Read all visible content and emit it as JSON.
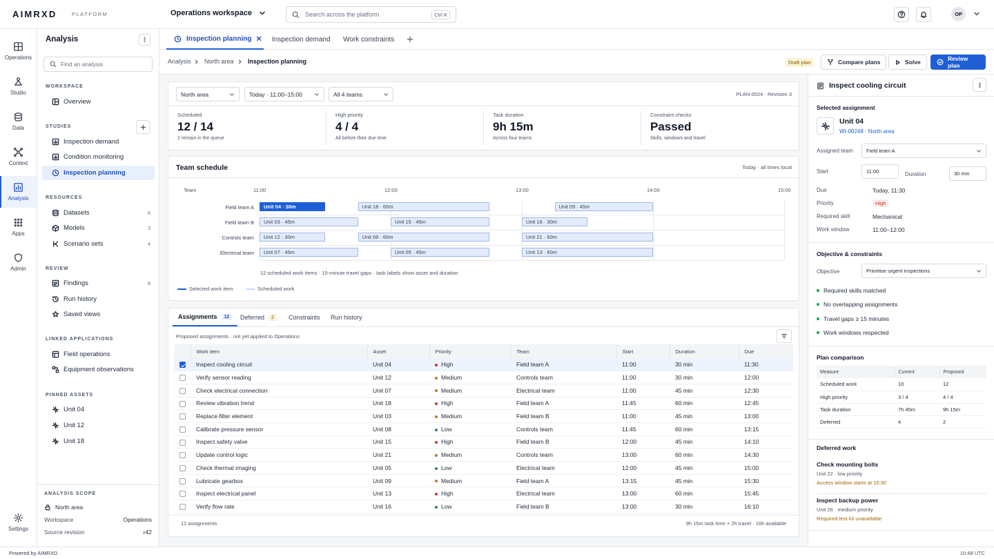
{
  "brand": {
    "name": "AIMRXD",
    "sub": "PLATFORM"
  },
  "workspace": "Operations workspace",
  "search": {
    "placeholder": "Search across the platform",
    "shortcut": "Ctrl K"
  },
  "user_initials": "OP",
  "rail": [
    {
      "label": "Operations",
      "icon": "grid-icon"
    },
    {
      "label": "Studio",
      "icon": "studio-icon"
    },
    {
      "label": "Data",
      "icon": "database-icon"
    },
    {
      "label": "Context",
      "icon": "graph-icon"
    },
    {
      "label": "Analysis",
      "icon": "chart-icon"
    },
    {
      "label": "Apps",
      "icon": "apps-icon"
    },
    {
      "label": "Admin",
      "icon": "shield-icon"
    }
  ],
  "rail_settings": "Settings",
  "sidebar": {
    "title": "Analysis",
    "search_placeholder": "Find an analysis",
    "workspace_head": "WORKSPACE",
    "overview": "Overview",
    "studies_head": "STUDIES",
    "studies": [
      "Inspection demand",
      "Condition monitoring",
      "Inspection planning"
    ],
    "resources_head": "RESOURCES",
    "resources": [
      {
        "label": "Datasets",
        "count": "6"
      },
      {
        "label": "Models",
        "count": "3"
      },
      {
        "label": "Scenario sets",
        "count": "4"
      }
    ],
    "review_head": "REVIEW",
    "review": [
      {
        "label": "Findings",
        "count": "8"
      },
      {
        "label": "Run history",
        "count": ""
      },
      {
        "label": "Saved views",
        "count": ""
      }
    ],
    "linked_head": "LINKED APPLICATIONS",
    "linked": [
      "Field operations",
      "Equipment observations"
    ],
    "pinned_head": "PINNED ASSETS",
    "pinned": [
      "Unit 04",
      "Unit 12",
      "Unit 18"
    ],
    "scope_head": "ANALYSIS SCOPE",
    "scope_area": "North area",
    "scope_workspace_label": "Workspace",
    "scope_workspace": "Operations",
    "scope_rev_label": "Source revision",
    "scope_rev": "r42"
  },
  "tabs": [
    "Inspection planning",
    "Inspection demand",
    "Work constraints"
  ],
  "breadcrumb": [
    "Analysis",
    "North area",
    "Inspection planning"
  ],
  "actions": {
    "draft": "Draft plan",
    "compare": "Compare plans",
    "solve": "Solve",
    "review": "Review plan"
  },
  "filters": {
    "area": "North area",
    "window": "Today · 11:00–15:00",
    "teams": "All 4 teams",
    "plan_id": "PLAN-0024 · Revision 3"
  },
  "kpis": [
    {
      "label": "Scheduled",
      "value": "12 / 14",
      "sub": "2 remain in the queue"
    },
    {
      "label": "High priority",
      "value": "4 / 4",
      "sub": "All before their due time"
    },
    {
      "label": "Task duration",
      "value": "9h 15m",
      "sub": "Across four teams"
    },
    {
      "label": "Constraint checks",
      "value": "Passed",
      "sub": "Skills, windows and travel"
    }
  ],
  "schedule": {
    "title": "Team schedule",
    "note": "Today · all times local",
    "team_col": "Team",
    "times": [
      "11:00",
      "12:00",
      "13:00",
      "14:00",
      "15:00"
    ],
    "teams": [
      "Field team A",
      "Field team B",
      "Controls team",
      "Electrical team"
    ],
    "tasks": [
      {
        "team": 0,
        "label": "Unit 04 · 30m",
        "start": 11.0,
        "end": 11.5,
        "selected": true
      },
      {
        "team": 0,
        "label": "Unit 18 · 60m",
        "start": 11.75,
        "end": 12.75,
        "selected": false
      },
      {
        "team": 0,
        "label": "Unit 09 · 45m",
        "start": 13.25,
        "end": 14.0,
        "selected": false
      },
      {
        "team": 1,
        "label": "Unit 03 · 45m",
        "start": 11.0,
        "end": 11.75,
        "selected": false
      },
      {
        "team": 1,
        "label": "Unit 15 · 45m",
        "start": 12.0,
        "end": 12.75,
        "selected": false
      },
      {
        "team": 1,
        "label": "Unit 16 · 30m",
        "start": 13.0,
        "end": 13.5,
        "selected": false
      },
      {
        "team": 2,
        "label": "Unit 12 · 30m",
        "start": 11.0,
        "end": 11.5,
        "selected": false
      },
      {
        "team": 2,
        "label": "Unit 08 · 60m",
        "start": 11.75,
        "end": 12.75,
        "selected": false
      },
      {
        "team": 2,
        "label": "Unit 21 · 60m",
        "start": 13.0,
        "end": 14.0,
        "selected": false
      },
      {
        "team": 3,
        "label": "Unit 07 · 45m",
        "start": 11.0,
        "end": 11.75,
        "selected": false
      },
      {
        "team": 3,
        "label": "Unit 05 · 45m",
        "start": 12.0,
        "end": 12.75,
        "selected": false
      },
      {
        "team": 3,
        "label": "Unit 13 · 60m",
        "start": 13.0,
        "end": 14.0,
        "selected": false
      }
    ],
    "caption": "12 scheduled work items · 15-minute travel gaps · task labels show asset and duration",
    "legend_selected": "Selected work item",
    "legend_scheduled": "Scheduled work"
  },
  "table_tabs": [
    {
      "label": "Assignments",
      "badge": "12"
    },
    {
      "label": "Deferred",
      "badge": "2"
    },
    {
      "label": "Constraints",
      "badge": ""
    },
    {
      "label": "Run history",
      "badge": ""
    }
  ],
  "table_note": "Proposed assignments · not yet applied to Operations",
  "columns": [
    "Work item",
    "Asset",
    "Priority",
    "Team",
    "Start",
    "Duration",
    "Due"
  ],
  "priority_colors": {
    "High": "#c0392b",
    "Medium": "#b7791f",
    "Low": "#2f855a"
  },
  "rows": [
    {
      "item": "Inspect cooling circuit",
      "asset": "Unit 04",
      "priority": "High",
      "team": "Field team A",
      "start": "11:00",
      "duration": "30 min",
      "due": "11:30",
      "checked": true
    },
    {
      "item": "Verify sensor reading",
      "asset": "Unit 12",
      "priority": "Medium",
      "team": "Controls team",
      "start": "11:00",
      "duration": "30 min",
      "due": "12:00",
      "checked": false
    },
    {
      "item": "Check electrical connection",
      "asset": "Unit 07",
      "priority": "Medium",
      "team": "Electrical team",
      "start": "11:00",
      "duration": "45 min",
      "due": "12:30",
      "checked": false
    },
    {
      "item": "Review vibration trend",
      "asset": "Unit 18",
      "priority": "High",
      "team": "Field team A",
      "start": "11:45",
      "duration": "60 min",
      "due": "12:45",
      "checked": false
    },
    {
      "item": "Replace filter element",
      "asset": "Unit 03",
      "priority": "Medium",
      "team": "Field team B",
      "start": "11:00",
      "duration": "45 min",
      "due": "13:00",
      "checked": false
    },
    {
      "item": "Calibrate pressure sensor",
      "asset": "Unit 08",
      "priority": "Low",
      "team": "Controls team",
      "start": "11:45",
      "duration": "60 min",
      "due": "13:15",
      "checked": false
    },
    {
      "item": "Inspect safety valve",
      "asset": "Unit 15",
      "priority": "High",
      "team": "Field team B",
      "start": "12:00",
      "duration": "45 min",
      "due": "14:10",
      "checked": false
    },
    {
      "item": "Update control logic",
      "asset": "Unit 21",
      "priority": "Medium",
      "team": "Controls team",
      "start": "13:00",
      "duration": "60 min",
      "due": "14:30",
      "checked": false
    },
    {
      "item": "Check thermal imaging",
      "asset": "Unit 05",
      "priority": "Low",
      "team": "Electrical team",
      "start": "12:00",
      "duration": "45 min",
      "due": "15:00",
      "checked": false
    },
    {
      "item": "Lubricate gearbox",
      "asset": "Unit 09",
      "priority": "Medium",
      "team": "Field team A",
      "start": "13:15",
      "duration": "45 min",
      "due": "15:30",
      "checked": false
    },
    {
      "item": "Inspect electrical panel",
      "asset": "Unit 13",
      "priority": "High",
      "team": "Electrical team",
      "start": "13:00",
      "duration": "60 min",
      "due": "15:45",
      "checked": false
    },
    {
      "item": "Verify flow rate",
      "asset": "Unit 16",
      "priority": "Low",
      "team": "Field team B",
      "start": "13:00",
      "duration": "30 min",
      "due": "16:10",
      "checked": false
    }
  ],
  "table_footer_left": "12 assignments",
  "table_footer_right": "9h 15m task time + 2h travel · 16h available",
  "detail": {
    "title": "Inspect cooling circuit",
    "selected_head": "Selected assignment",
    "unit": "Unit 04",
    "unit_ref": "WI-00248 · North area",
    "assigned_label": "Assigned team",
    "assigned": "Field team A",
    "start_label": "Start",
    "start": "11:00",
    "duration_label": "Duration",
    "duration": "30 min",
    "due_label": "Due",
    "due": "Today, 11:30",
    "priority_label": "Priority",
    "priority": "High",
    "skill_label": "Required skill",
    "skill": "Mechanical",
    "window_label": "Work window",
    "window": "11:00–12:00",
    "objective_head": "Objective & constraints",
    "objective_label": "Objective",
    "objective": "Prioritise urgent inspections",
    "checks": [
      "Required skills matched",
      "No overlapping assignments",
      "Travel gaps ≥ 15 minutes",
      "Work windows respected"
    ],
    "comparison_head": "Plan comparison",
    "comparison_cols": [
      "Measure",
      "Current",
      "Proposed"
    ],
    "comparison": [
      [
        "Scheduled work",
        "10",
        "12"
      ],
      [
        "High priority",
        "3 / 4",
        "4 / 4"
      ],
      [
        "Task duration",
        "7h 45m",
        "9h 15m"
      ],
      [
        "Deferred",
        "4",
        "2"
      ]
    ],
    "deferred_head": "Deferred work",
    "deferred": [
      {
        "title": "Check mounting bolts",
        "meta": "Unit 22 · low priority",
        "reason": "Access window starts at 15:30"
      },
      {
        "title": "Inspect backup power",
        "meta": "Unit 26 · medium priority",
        "reason": "Required test kit unavailable"
      }
    ]
  },
  "footer": {
    "left": "Powered by AIMRXD",
    "right": "10:48 UTC"
  }
}
